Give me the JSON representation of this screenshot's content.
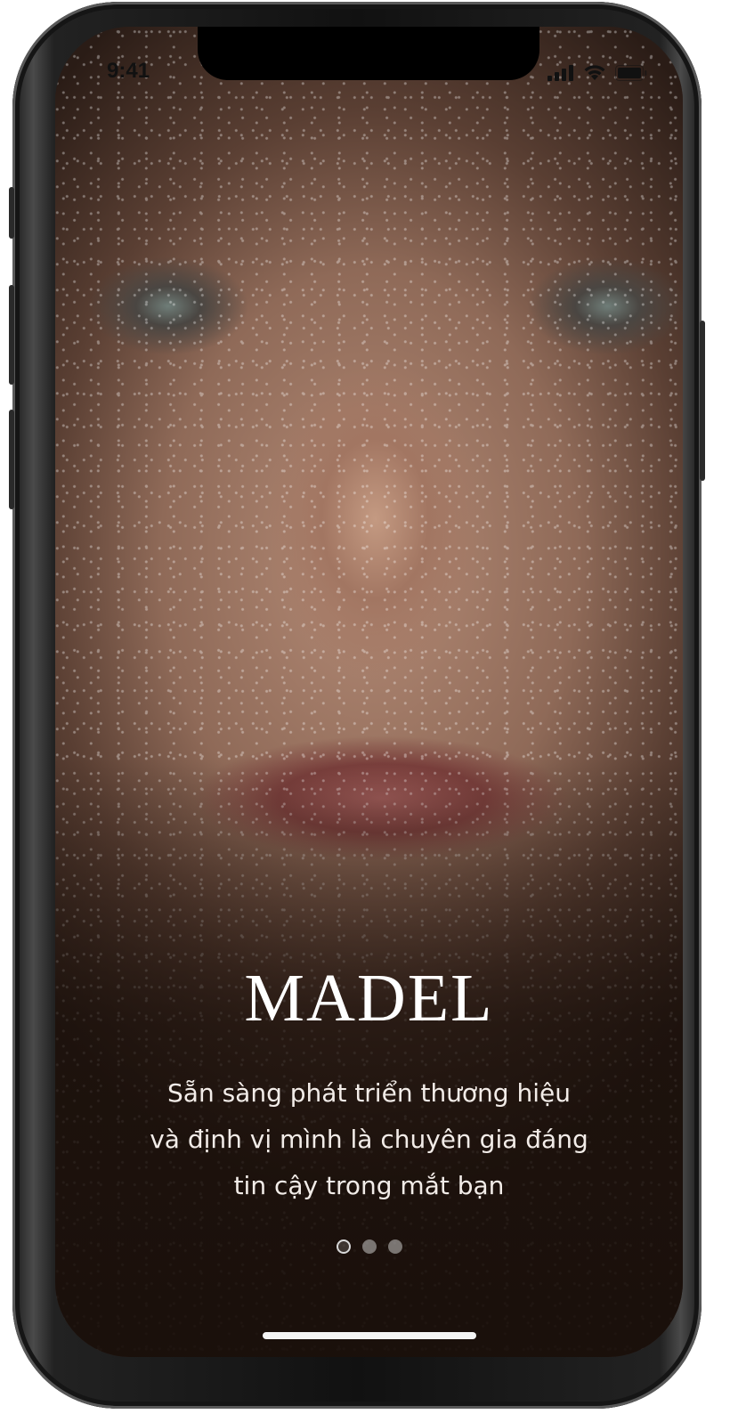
{
  "status_bar": {
    "time": "9:41",
    "icons": [
      "signal-icon",
      "wifi-icon",
      "battery-icon"
    ]
  },
  "onboarding": {
    "title": "MADEL",
    "subtitle_lines": [
      "Sẵn sàng phát triển thương hiệu",
      "và định vị mình là chuyên gia đáng",
      "tin cậy trong mắt bạn"
    ],
    "page_indicator": {
      "pages": 3,
      "current": 1
    }
  },
  "colors": {
    "text": "#ffffff",
    "dot_inactive": "#c8c8c8",
    "frame": "#1a1a1a"
  }
}
